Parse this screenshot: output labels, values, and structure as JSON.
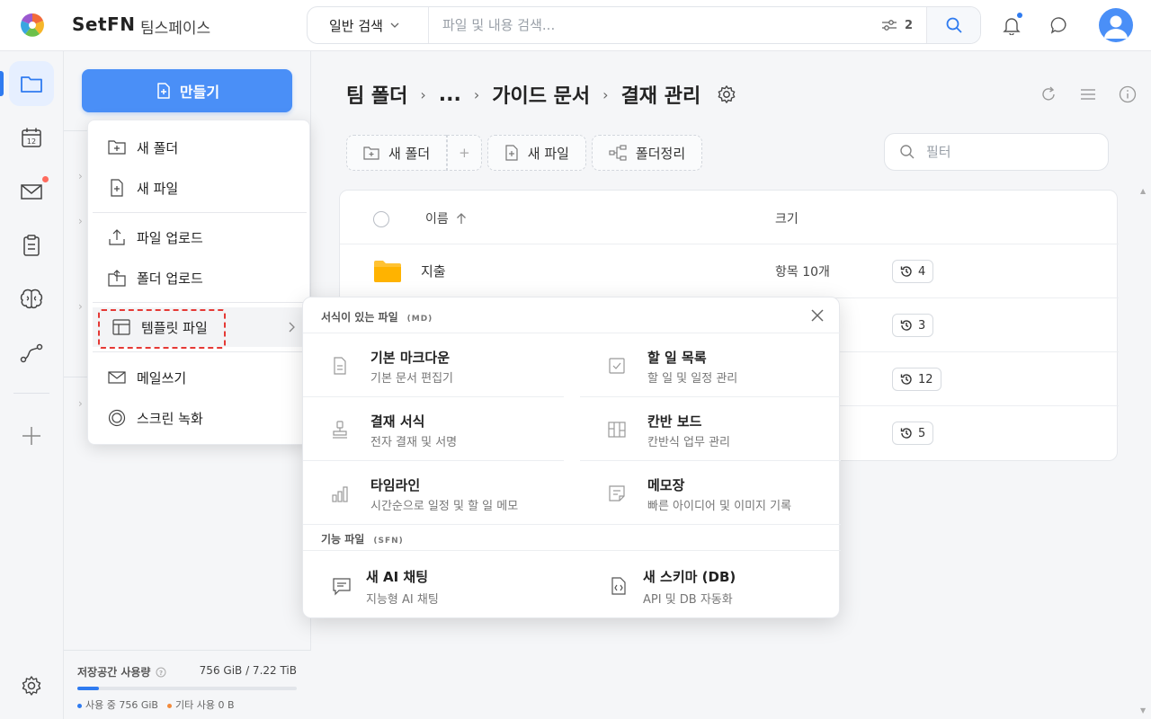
{
  "header": {
    "brand": "SetFN",
    "workspace": "팀스페이스",
    "search": {
      "mode": "일반 검색",
      "placeholder": "파일 및 내용 검색...",
      "filter_count": "2"
    }
  },
  "breadcrumb": {
    "items": [
      "팀 폴더",
      "...",
      "가이드 문서",
      "결재 관리"
    ]
  },
  "left_panel": {
    "create_label": "만들기",
    "storage": {
      "label": "저장공간 사용량",
      "value": "756 GiB / 7.22 TiB",
      "used_fraction": 0.1,
      "used_legend": "사용 중 756 GiB",
      "other_legend": "기타 사용 0 B"
    }
  },
  "create_menu": {
    "new_folder": "새 폴더",
    "new_file": "새 파일",
    "upload_file": "파일 업로드",
    "upload_folder": "폴더 업로드",
    "template_file": "템플릿 파일",
    "write_mail": "메일쓰기",
    "screen_record": "스크린 녹화"
  },
  "toolbar": {
    "new_folder": "새 폴더",
    "add": "+",
    "new_file": "새 파일",
    "organize": "폴더정리",
    "filter_placeholder": "필터"
  },
  "table": {
    "col_name": "이름",
    "col_size": "크기",
    "rows": [
      {
        "name": "지출",
        "size": "항목 10개",
        "versions": "4"
      },
      {
        "name": "",
        "size": "",
        "versions": "3"
      },
      {
        "name": "",
        "size": "",
        "versions": "12"
      },
      {
        "name": "",
        "size": "",
        "versions": "5"
      }
    ]
  },
  "template_menu": {
    "section1_title": "서식이 있는 파일",
    "section1_tag": "(MD)",
    "section2_title": "기능 파일",
    "section2_tag": "(SFN)",
    "items": [
      {
        "title": "기본 마크다운",
        "desc": "기본 문서 편집기"
      },
      {
        "title": "할 일 목록",
        "desc": "할 일 및 일정 관리"
      },
      {
        "title": "결재 서식",
        "desc": "전자 결재 및 서명"
      },
      {
        "title": "칸반 보드",
        "desc": "칸반식 업무 관리"
      },
      {
        "title": "타임라인",
        "desc": "시간순으로 일정 및 할 일 메모"
      },
      {
        "title": "메모장",
        "desc": "빠른 아이디어 및 이미지 기록"
      }
    ],
    "function_items": [
      {
        "title": "새 AI 채팅",
        "desc": "지능형 AI 채팅"
      },
      {
        "title": "새 스키마 (DB)",
        "desc": "API 및 DB 자동화"
      }
    ]
  },
  "colors": {
    "accent": "#4a8ff7",
    "highlight_border": "#e53935",
    "folder": "#ffc233"
  }
}
